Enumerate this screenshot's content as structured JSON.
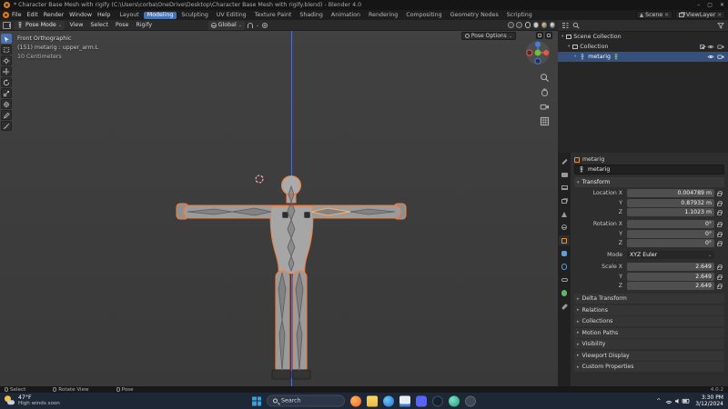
{
  "window": {
    "title": "* Character Base Mesh with rigify (C:\\Users\\corba\\OneDrive\\Desktop\\Character Base Mesh with rigify.blend) - Blender 4.0"
  },
  "icons": {
    "caret_down": "⌄",
    "caret_expanded": "▾",
    "caret_collapsed": "▸",
    "close": "✕",
    "minimize": "–",
    "maximize": "▢",
    "chevron_up": "^"
  },
  "menubar": {
    "menus": [
      "File",
      "Edit",
      "Render",
      "Window",
      "Help"
    ],
    "workspaces": [
      "Layout",
      "Modeling",
      "Sculpting",
      "UV Editing",
      "Texture Paint",
      "Shading",
      "Animation",
      "Rendering",
      "Compositing",
      "Geometry Nodes",
      "Scripting"
    ],
    "scene": "Scene",
    "view_layer": "ViewLayer"
  },
  "tool_header": {
    "mode": "Pose Mode",
    "menus": [
      "View",
      "Select",
      "Pose",
      "Rigify"
    ],
    "orientation": "Global",
    "pose_options": "Pose Options"
  },
  "viewport": {
    "view_label": "Front Orthographic",
    "active_label": "(151) metarig : upper_arm.L",
    "unit_label": "10 Centimeters"
  },
  "outliner": {
    "rows": [
      {
        "label": "Scene Collection"
      },
      {
        "label": "Collection"
      },
      {
        "label": "metarig"
      }
    ]
  },
  "properties": {
    "breadcrumb": "metarig",
    "name": "metarig",
    "transform_title": "Transform",
    "fields": [
      {
        "label": "Location X",
        "value": "0.004789 m"
      },
      {
        "label": "Y",
        "value": "0.87932 m"
      },
      {
        "label": "Z",
        "value": "1.1023 m"
      },
      {
        "label": "Rotation X",
        "value": "0°"
      },
      {
        "label": "Y",
        "value": "0°"
      },
      {
        "label": "Z",
        "value": "0°"
      },
      {
        "label": "Mode",
        "value": "XYZ Euler"
      },
      {
        "label": "Scale X",
        "value": "2.649"
      },
      {
        "label": "Y",
        "value": "2.649"
      },
      {
        "label": "Z",
        "value": "2.649"
      }
    ],
    "sections": [
      "Delta Transform",
      "Relations",
      "Collections",
      "Motion Paths",
      "Visibility",
      "Viewport Display",
      "Custom Properties"
    ]
  },
  "statusbar": {
    "hint_select": "Select",
    "hint_rotate": "Rotate View",
    "hint_pose": "Pose",
    "version": "4.0.2"
  },
  "taskbar": {
    "weather_temp": "47°F",
    "weather_desc": "High winds soon",
    "search_placeholder": "Search",
    "time": "3:30 PM",
    "date": "3/12/2024"
  },
  "colors": {
    "accent": "#4772b3",
    "selection_outline": "#f08040"
  }
}
